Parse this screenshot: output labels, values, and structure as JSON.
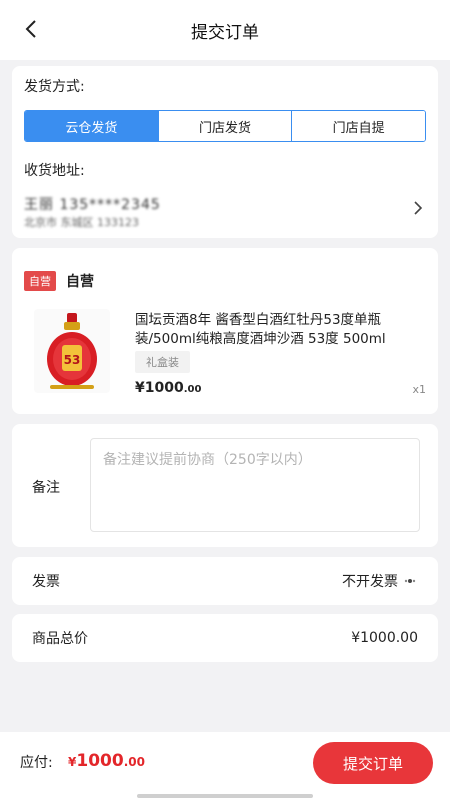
{
  "header": {
    "title": "提交订单"
  },
  "shipping": {
    "label": "发货方式:",
    "options": [
      "云仓发货",
      "门店发货",
      "门店自提"
    ],
    "selected": "云仓发货",
    "address_label": "收货地址:",
    "address_name": "王丽 135****2345",
    "address_detail": "北京市 东城区 133123"
  },
  "order": {
    "shop_badge": "自营",
    "shop_name": "自营",
    "product_title": "国坛贡酒8年 酱香型白酒红牡丹53度单瓶装/500ml纯粮高度酒坤沙酒 53度 500ml",
    "spec": "礼盒装",
    "price_symbol": "¥",
    "price_int": "1000",
    "price_dec": ".00",
    "qty": "x1"
  },
  "note": {
    "label": "备注",
    "placeholder": "备注建议提前协商（250字以内）"
  },
  "invoice": {
    "label": "发票",
    "value": "不开发票"
  },
  "total": {
    "label": "商品总价",
    "value": "¥1000.00"
  },
  "footer": {
    "pay_label": "应付:",
    "pay_symbol": "¥",
    "pay_int": "1000",
    "pay_dec": ".00",
    "submit_label": "提交订单"
  },
  "colors": {
    "accent_blue": "#3a8ef0",
    "price_red": "#e3262a",
    "button_red": "#e8363a"
  }
}
